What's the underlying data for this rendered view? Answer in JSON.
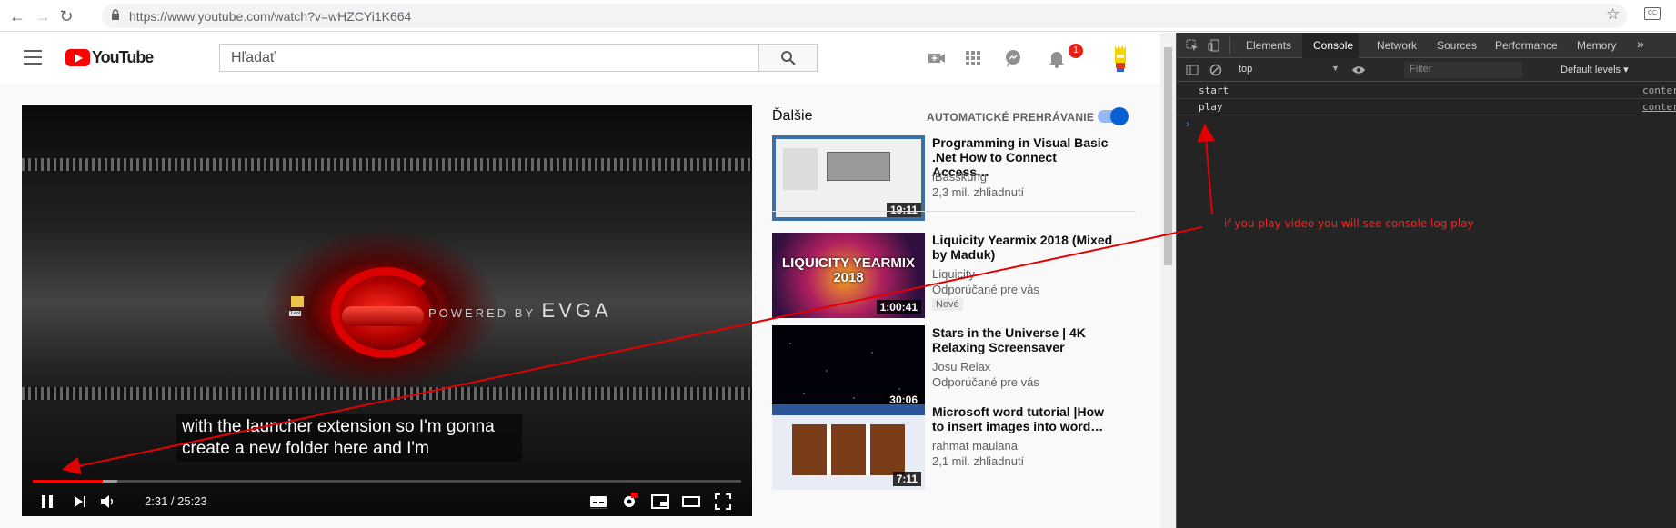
{
  "browser": {
    "url": "https://www.youtube.com/watch?v=wHZCYi1K664",
    "icons": [
      "back-icon",
      "forward-icon",
      "reload-icon",
      "lock-icon",
      "star-icon",
      "extension-icon"
    ]
  },
  "youtube": {
    "logo_text": "YouTube",
    "search_placeholder": "Hľadať",
    "notification_count": "1",
    "player": {
      "caption_line1": "with the launcher extension so I'm gonna",
      "caption_line2": "create a new folder here and I'm",
      "time": "2:31 / 25:23",
      "progress_fraction": 0.099,
      "buffered_fraction": 0.12,
      "wallpaper_text": "POWERED BY",
      "wallpaper_brand": "EVGA",
      "folder_label": "1.eol"
    },
    "sidebar": {
      "next_label": "Ďalšie",
      "autoplay_label": "AUTOMATICKÉ PREHRÁVANIE",
      "autoplay_on": true,
      "videos": [
        {
          "title": "Programming in Visual Basic .Net How to Connect Access…",
          "channel": "iBasskung",
          "meta": "2,3 mil. zhliadnutí",
          "badge": "",
          "duration": "19:11"
        },
        {
          "title": "Liquicity Yearmix 2018 (Mixed by Maduk)",
          "channel": "Liquicity",
          "meta": "Odporúčané pre vás",
          "badge": "Nové",
          "duration": "1:00:41",
          "thumb_text": "LIQUICITY YEARMIX 2018"
        },
        {
          "title": "Stars in the Universe | 4K Relaxing Screensaver",
          "channel": "Josu Relax",
          "meta": "Odporúčané pre vás",
          "badge": "",
          "duration": "30:06"
        },
        {
          "title": "Microsoft word tutorial |How to insert images into word…",
          "channel": "rahmat maulana",
          "meta": "2,1 mil. zhliadnutí",
          "badge": "",
          "duration": "7:11"
        }
      ]
    }
  },
  "devtools": {
    "tabs": [
      "Elements",
      "Console",
      "Network",
      "Sources",
      "Performance",
      "Memory",
      "»"
    ],
    "active_tab": "Console",
    "context": "top",
    "filter_placeholder": "Filter",
    "levels": "Default levels ▾",
    "logs": [
      {
        "text": "start",
        "source": "conter"
      },
      {
        "text": "play",
        "source": "conter"
      }
    ],
    "prompt": "›"
  },
  "annotation": {
    "text": "if you play video you will see console log play",
    "color": "#ff2020"
  }
}
